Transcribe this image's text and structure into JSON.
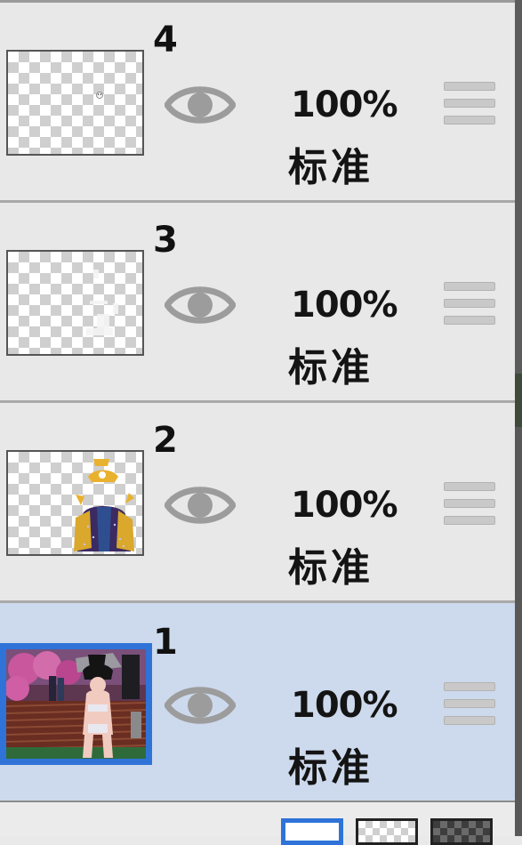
{
  "layers_panel": {
    "accent_color": "#2f73d8",
    "selected_row_color": "#cdd9ec",
    "layers": [
      {
        "number": "4",
        "opacity": "100%",
        "blend_mode": "标准",
        "visible": true,
        "selected": false
      },
      {
        "number": "3",
        "opacity": "100%",
        "blend_mode": "标准",
        "visible": true,
        "selected": false
      },
      {
        "number": "2",
        "opacity": "100%",
        "blend_mode": "标准",
        "visible": true,
        "selected": false
      },
      {
        "number": "1",
        "opacity": "100%",
        "blend_mode": "标准",
        "visible": true,
        "selected": true
      }
    ]
  },
  "background_options": {
    "items": [
      "white",
      "checker-light",
      "checker-dark"
    ],
    "selected": "white"
  },
  "icons": {
    "visibility": "eye-icon",
    "reorder": "drag-handle-icon"
  }
}
